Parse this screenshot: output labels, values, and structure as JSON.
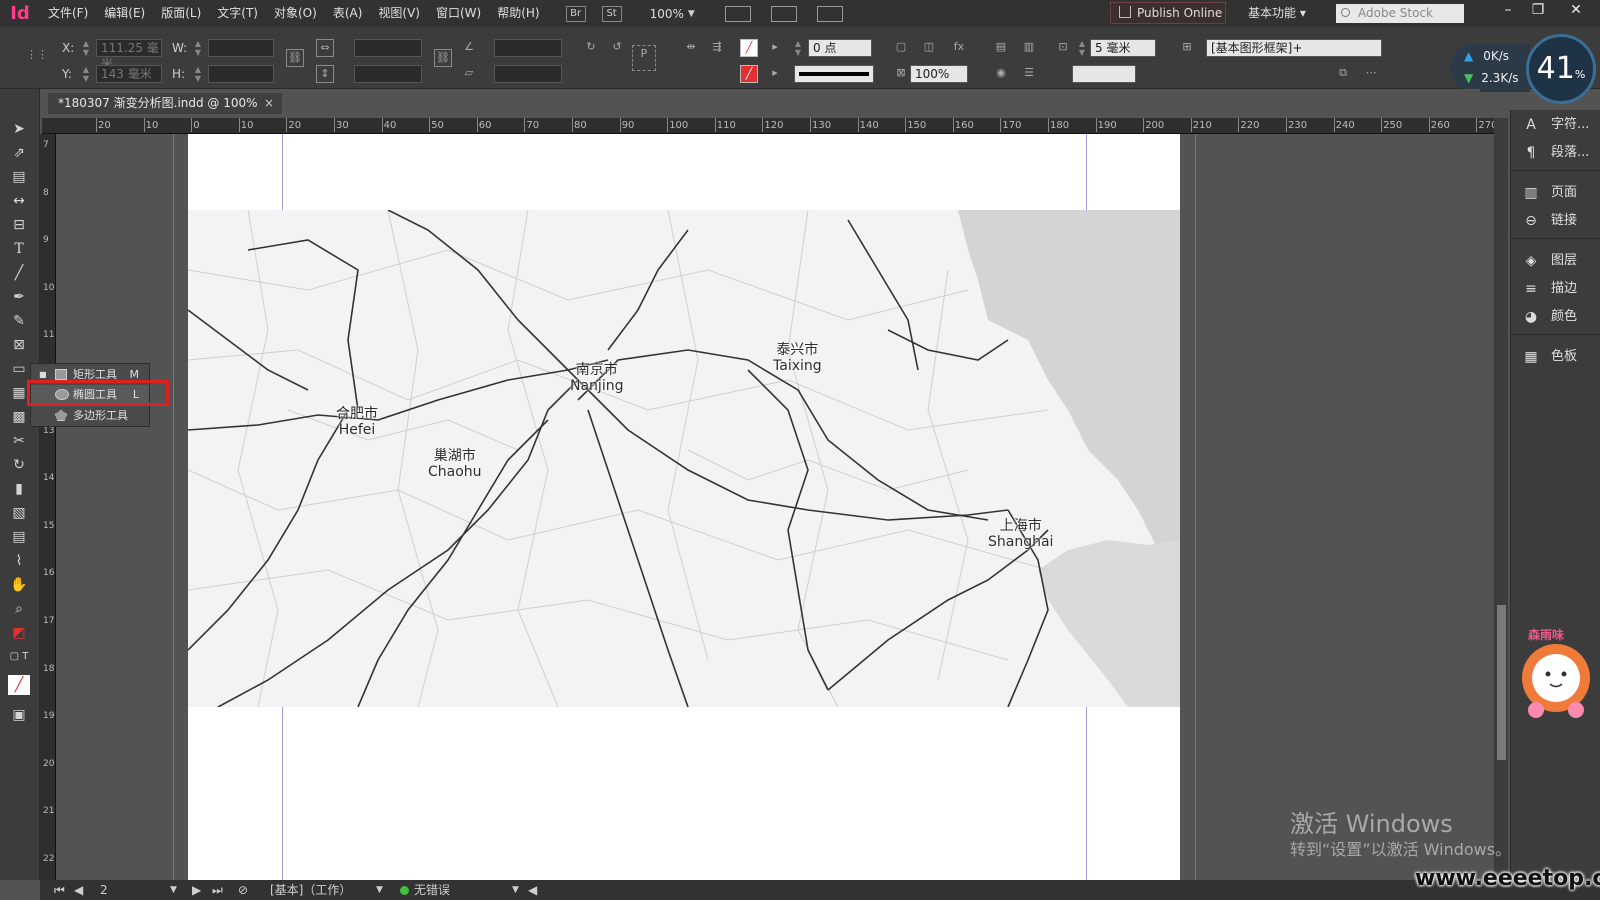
{
  "app": {
    "logo": "Id"
  },
  "menu": [
    "文件(F)",
    "编辑(E)",
    "版面(L)",
    "文字(T)",
    "对象(O)",
    "表(A)",
    "视图(V)",
    "窗口(W)",
    "帮助(H)"
  ],
  "menubar": {
    "bridge": "Br",
    "stock_app": "St",
    "zoom": "100%",
    "publish": "Publish Online",
    "workspace": "基本功能",
    "stock_search": "Adobe Stock"
  },
  "control": {
    "x_label": "X:",
    "x_value": "111.25 毫米",
    "y_label": "Y:",
    "y_value": "143 毫米",
    "w_label": "W:",
    "h_label": "H:",
    "stroke_weight": "0 点",
    "opacity": "100%",
    "spacing": "5 毫米",
    "frame_style": "[基本图形框架]+"
  },
  "network": {
    "up": "0K/s",
    "down": "2.3K/s",
    "cpu": "41",
    "cpu_unit": "%"
  },
  "tab": {
    "title": "*180307 渐变分析图.indd @ 100%",
    "close": "×"
  },
  "ruler_h": [
    "20",
    "10",
    "0",
    "10",
    "20",
    "30",
    "40",
    "50",
    "60",
    "70",
    "80",
    "90",
    "100",
    "110",
    "120",
    "130",
    "140",
    "150",
    "160",
    "170",
    "180",
    "190",
    "200",
    "210",
    "220",
    "230",
    "240",
    "250",
    "260",
    "270"
  ],
  "ruler_v": [
    "7",
    "8",
    "9",
    "10",
    "11",
    "12",
    "13",
    "14",
    "15",
    "16",
    "17",
    "18",
    "19",
    "20",
    "21",
    "22"
  ],
  "map": {
    "labels": [
      {
        "zh": "南京市",
        "en": "Nanjing"
      },
      {
        "zh": "泰兴市",
        "en": "Taixing"
      },
      {
        "zh": "合肥市",
        "en": "Hefei"
      },
      {
        "zh": "巢湖市",
        "en": "Chaohu"
      },
      {
        "zh": "上海市",
        "en": "Shanghai"
      }
    ]
  },
  "flyout": [
    {
      "label": "矩形工具",
      "key": "M"
    },
    {
      "label": "椭圆工具",
      "key": "L"
    },
    {
      "label": "多边形工具",
      "key": ""
    }
  ],
  "panels": [
    "字符...",
    "段落...",
    "页面",
    "链接",
    "图层",
    "描边",
    "颜色",
    "色板"
  ],
  "status": {
    "page": "2",
    "profile": "[基本]（工作）",
    "preflight": "无错误"
  },
  "watermark": {
    "activate": "激活 Windows",
    "activate_sub": "转到“设置”以激活 Windows。",
    "site": "www.eeeetop.com",
    "mascot_text": "森雨味"
  },
  "colors": {
    "accent": "#ff3d8b",
    "highlight": "#e02020",
    "guide": "#9c9cd8",
    "bleed": "#cc5555"
  }
}
